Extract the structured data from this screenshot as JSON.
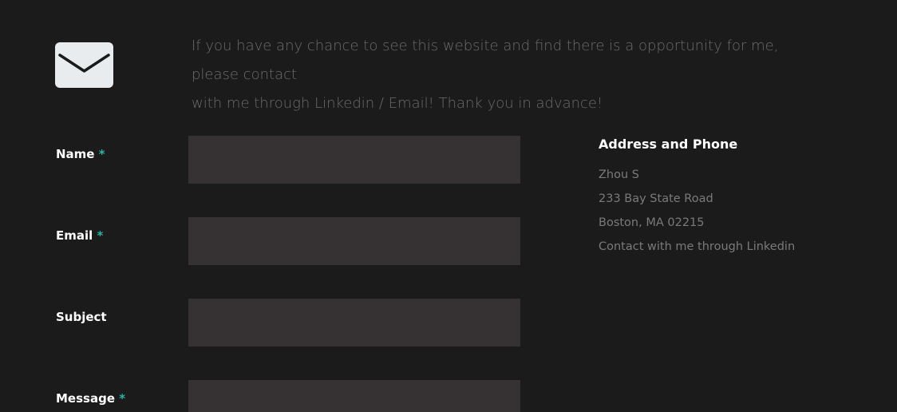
{
  "icons": {
    "mail": "envelope-icon"
  },
  "colors": {
    "background": "#1b1b1b",
    "input_bg": "#363233",
    "required_marker": "#2bb3a7",
    "muted_text": "#6b6b6b"
  },
  "intro": {
    "text_line1": "If you have any chance to see this website and find there is a opportunity for me, please contact",
    "text_line2": "with me through Linkedin / Email! Thank you in advance!"
  },
  "form": {
    "name_label": "Name",
    "email_label": "Email",
    "subject_label": "Subject",
    "message_label": "Message",
    "required_marker": "*",
    "name_value": "",
    "email_value": "",
    "subject_value": "",
    "message_value": ""
  },
  "address": {
    "heading": "Address and Phone",
    "lines": [
      "Zhou S",
      "233 Bay State Road",
      "Boston, MA 02215",
      "Contact with me through Linkedin"
    ]
  }
}
